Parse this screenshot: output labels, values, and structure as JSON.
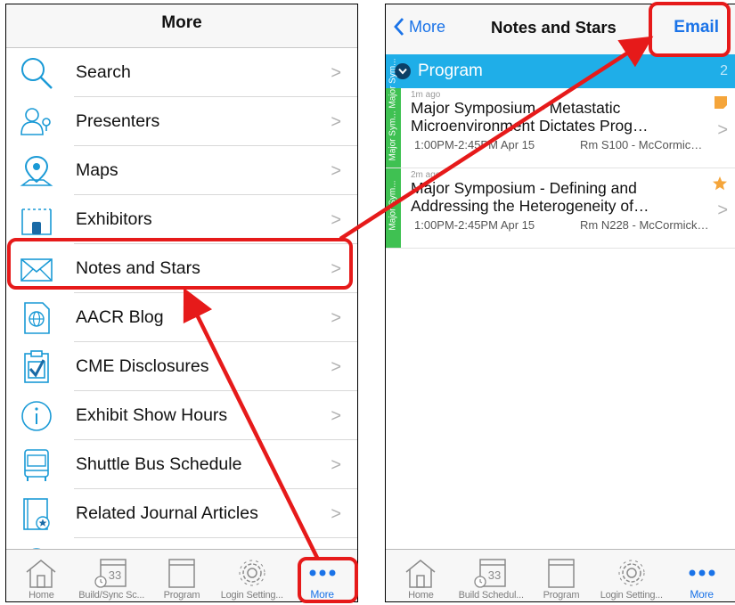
{
  "left": {
    "nav_title": "More",
    "menu": [
      {
        "label": "Search",
        "icon": "search-icon"
      },
      {
        "label": "Presenters",
        "icon": "presenters-icon"
      },
      {
        "label": "Maps",
        "icon": "map-pin-icon"
      },
      {
        "label": "Exhibitors",
        "icon": "exhibitors-icon"
      },
      {
        "label": "Notes and Stars",
        "icon": "envelope-icon"
      },
      {
        "label": "AACR Blog",
        "icon": "blog-icon"
      },
      {
        "label": "CME Disclosures",
        "icon": "clipboard-check-icon"
      },
      {
        "label": "Exhibit Show Hours",
        "icon": "info-icon"
      },
      {
        "label": "Shuttle Bus Schedule",
        "icon": "bus-icon"
      },
      {
        "label": "Related Journal Articles",
        "icon": "journal-icon"
      }
    ],
    "chevron": ">",
    "tabs": [
      {
        "label": "Home",
        "icon": "home-icon"
      },
      {
        "label": "Build/Sync Sc...",
        "icon": "calendar-icon"
      },
      {
        "label": "Program",
        "icon": "program-icon"
      },
      {
        "label": "Login Setting...",
        "icon": "gear-icon"
      },
      {
        "label": "More",
        "icon": "more-icon"
      }
    ],
    "calendar_day": "33"
  },
  "right": {
    "back_label": "More",
    "nav_title": "Notes and Stars",
    "email_label": "Email",
    "section": {
      "name": "Program",
      "count": "2"
    },
    "sessions": [
      {
        "ago": "1m ago",
        "title": "Major Symposium - Metastatic Microenvironment Dictates Prog…",
        "time": "1:00PM-2:45PM  Apr 15",
        "room": "Rm S100  - McCormic…",
        "strip": "Major Sym...   Major Sym...",
        "badge": "note-icon"
      },
      {
        "ago": "2m ago",
        "title": "Major Symposium - Defining and Addressing the Heterogeneity of…",
        "time": "1:00PM-2:45PM  Apr 15",
        "room": "Rm N228 - McCormick…",
        "strip": "Major Sym...",
        "badge": "star-icon"
      }
    ],
    "tabs": [
      {
        "label": "Home",
        "icon": "home-icon"
      },
      {
        "label": "Build Schedul...",
        "icon": "calendar-icon"
      },
      {
        "label": "Program",
        "icon": "program-icon"
      },
      {
        "label": "Login Setting...",
        "icon": "gear-icon"
      },
      {
        "label": "More",
        "icon": "more-icon"
      }
    ]
  },
  "colors": {
    "accent": "#1a73e8",
    "section_header": "#1faee8",
    "strip": "#3fc152",
    "annotation": "#e61a1a",
    "note_badge": "#f5a53a"
  }
}
